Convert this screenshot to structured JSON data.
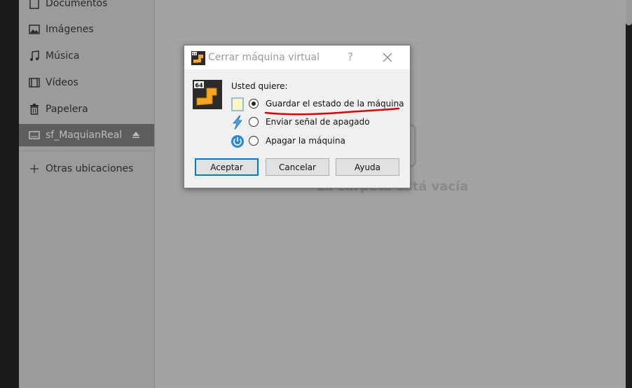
{
  "sidebar": {
    "items": [
      {
        "label": "Documentos",
        "icon": "document-icon"
      },
      {
        "label": "Imágenes",
        "icon": "image-icon"
      },
      {
        "label": "Música",
        "icon": "music-icon"
      },
      {
        "label": "Vídeos",
        "icon": "video-icon"
      },
      {
        "label": "Papelera",
        "icon": "trash-icon"
      },
      {
        "label": "sf_MaquianReal",
        "icon": "drive-icon",
        "active": true,
        "eject_icon": "eject-icon"
      },
      {
        "label": "Otras ubicaciones",
        "icon": "plus-icon"
      }
    ]
  },
  "content": {
    "empty_message": "La carpeta está vacía"
  },
  "dialog": {
    "title": "Cerrar máquina virtual",
    "help_label": "?",
    "app_icon_badge": "64",
    "prompt": "Usted quiere:",
    "options": [
      {
        "label": "Guardar el estado de la máquina",
        "icon": "save-state-icon",
        "selected": true
      },
      {
        "label": "Enviar señal de apagado",
        "icon": "lightning-icon",
        "selected": false
      },
      {
        "label": "Apagar la máquina",
        "icon": "power-icon",
        "selected": false
      }
    ],
    "buttons": {
      "ok": "Aceptar",
      "cancel": "Cancelar",
      "help": "Ayuda"
    },
    "annotation_color": "#e00000"
  }
}
